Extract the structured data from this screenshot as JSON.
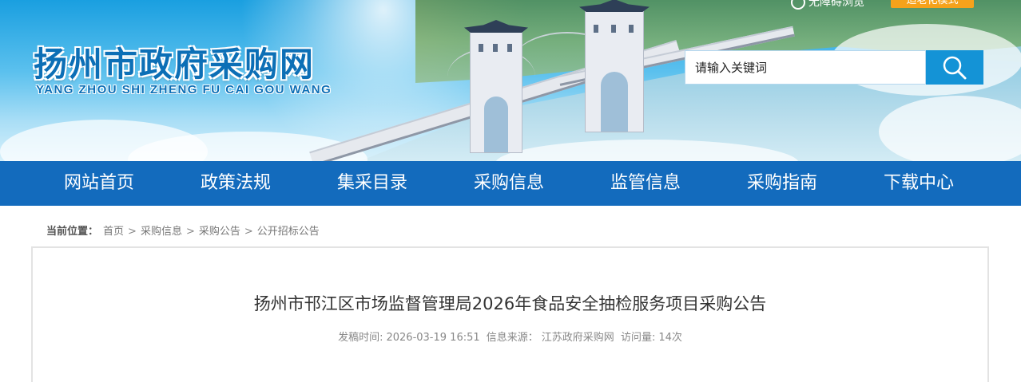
{
  "header": {
    "logo_cn": "扬州市政府采购网",
    "logo_en": "YANG ZHOU SHI ZHENG FU CAI GOU WANG",
    "top_link": "无障碍浏览",
    "top_button": "适老化模式",
    "search_placeholder": "请输入关键词",
    "search_icon": "search-icon"
  },
  "nav": {
    "items": [
      "网站首页",
      "政策法规",
      "集采目录",
      "采购信息",
      "监管信息",
      "采购指南",
      "下载中心"
    ]
  },
  "breadcrumb": {
    "label": "当前位置：",
    "items": [
      "首页",
      "采购信息",
      "采购公告",
      "公开招标公告"
    ],
    "separator": ">"
  },
  "article": {
    "title": "扬州市邗江区市场监督管理局2026年食品安全抽检服务项目采购公告",
    "publish_label": "发稿时间:",
    "publish_time": "2026-03-19 16:51",
    "source_label": "信息来源：",
    "source": "江苏政府采购网",
    "views_label": "访问量:",
    "views": "14次"
  },
  "colors": {
    "nav_bg": "#136bbd",
    "logo_blue": "#0c6fb6",
    "search_button": "#1493d6",
    "top_button": "#f6a21b"
  }
}
